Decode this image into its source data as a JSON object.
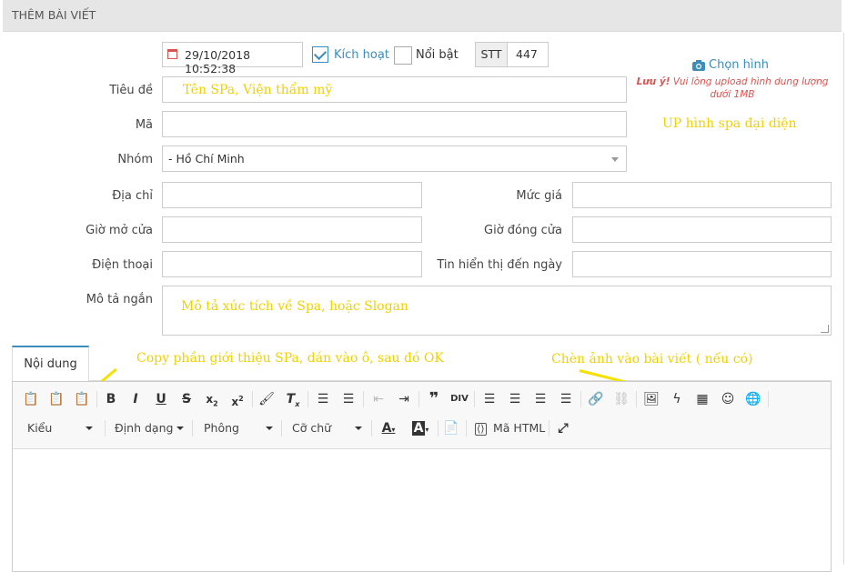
{
  "header": {
    "title": "THÊM BÀI VIẾT"
  },
  "datetime": "29/10/2018 10:52:38",
  "active_label": "Kích hoạt",
  "featured_label": "Nổi bật",
  "stt": {
    "label": "STT",
    "value": "447"
  },
  "image": {
    "choose_label": "Chọn hình",
    "note_prefix": "Lưu ý!",
    "note_line1": "Vui lòng upload hình dung lượng",
    "note_line2": "dưới 1MB"
  },
  "form": {
    "title_label": "Tiêu đề",
    "code_label": "Mã",
    "group_label": "Nhóm",
    "group_value": "- Hồ Chí Minh",
    "address_label": "Địa chỉ",
    "price_label": "Mức giá",
    "open_label": "Giờ mở cửa",
    "close_label": "Giờ đóng cửa",
    "phone_label": "Điện thoại",
    "until_label": "Tin hiển thị đến ngày",
    "desc_label": "Mô tả ngắn"
  },
  "annotations": {
    "title_hint": "Tên SPa, Viện thẩm mỹ",
    "upload_hint": "UP hình spa đại diện",
    "desc_hint": "Mô tả xúc tích về Spa, hoặc Slogan",
    "paste_hint": "Copy phần giới thiệu SPa, dán vào ô, sau đó OK",
    "image_hint": "Chèn ảnh vào bài viết ( nếu có)"
  },
  "tab": {
    "content_label": "Nội dung"
  },
  "toolbar": {
    "style_label": "Kiểu",
    "format_label": "Định dạng",
    "font_label": "Phông",
    "size_label": "Cỡ chữ",
    "html_label": "Mã HTML"
  },
  "colors": {
    "accent": "#3c8dbc",
    "annotation": "#f0d000",
    "warning": "#d9534f"
  }
}
